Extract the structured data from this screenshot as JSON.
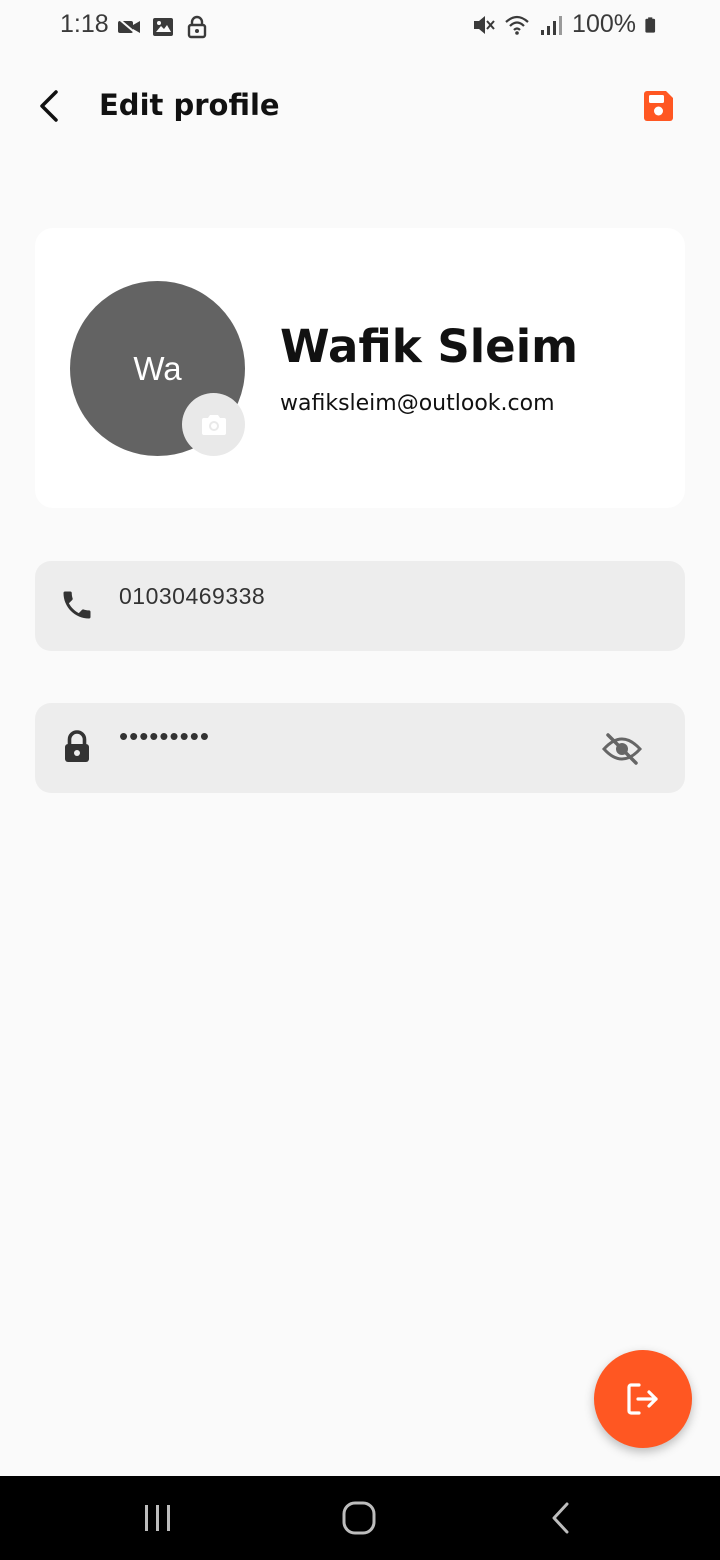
{
  "status_bar": {
    "time": "1:18",
    "battery": "100%",
    "icons_left": [
      "video-call-icon",
      "image-icon",
      "lock-icon"
    ],
    "icons_right": [
      "mute-icon",
      "wifi-icon",
      "signal-icon",
      "battery-icon"
    ]
  },
  "app_bar": {
    "title": "Edit profile",
    "back_icon": "back-arrow-icon",
    "save_icon": "save-icon"
  },
  "profile": {
    "initials": "Wa",
    "name": "Wafik Sleim",
    "email": "wafiksleim@outlook.com",
    "camera_icon": "camera-icon"
  },
  "fields": {
    "phone": {
      "icon": "phone-icon",
      "value": "01030469338"
    },
    "password": {
      "icon": "lock-icon",
      "value": "•••••••••",
      "toggle_icon": "eye-off-icon"
    }
  },
  "fab": {
    "icon": "logout-icon"
  },
  "colors": {
    "accent": "#ff5722",
    "background": "#fafafa",
    "card": "#ffffff",
    "field": "#ededed",
    "avatar": "#636363"
  },
  "nav_bar": {
    "buttons": [
      "recents-icon",
      "home-icon",
      "back-icon"
    ]
  }
}
